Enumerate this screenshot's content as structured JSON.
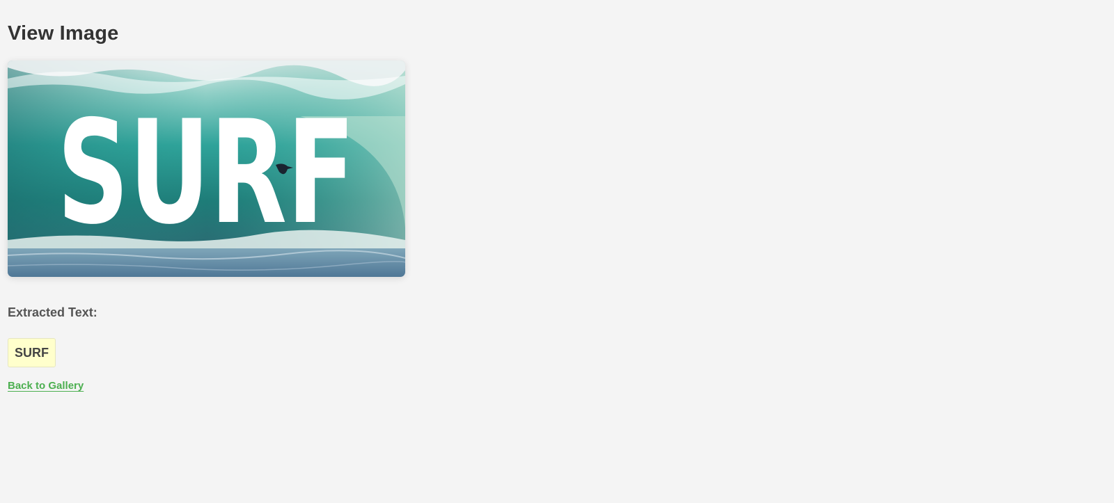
{
  "page": {
    "title": "View Image"
  },
  "image": {
    "overlay_text": "SURF",
    "alt": "Surf wave image"
  },
  "extracted": {
    "label": "Extracted Text:",
    "value": "SURF"
  },
  "navigation": {
    "back_label": "Back to Gallery"
  },
  "colors": {
    "background": "#f4f4f4",
    "link": "#4caf50",
    "highlight": "#ffffcc"
  }
}
